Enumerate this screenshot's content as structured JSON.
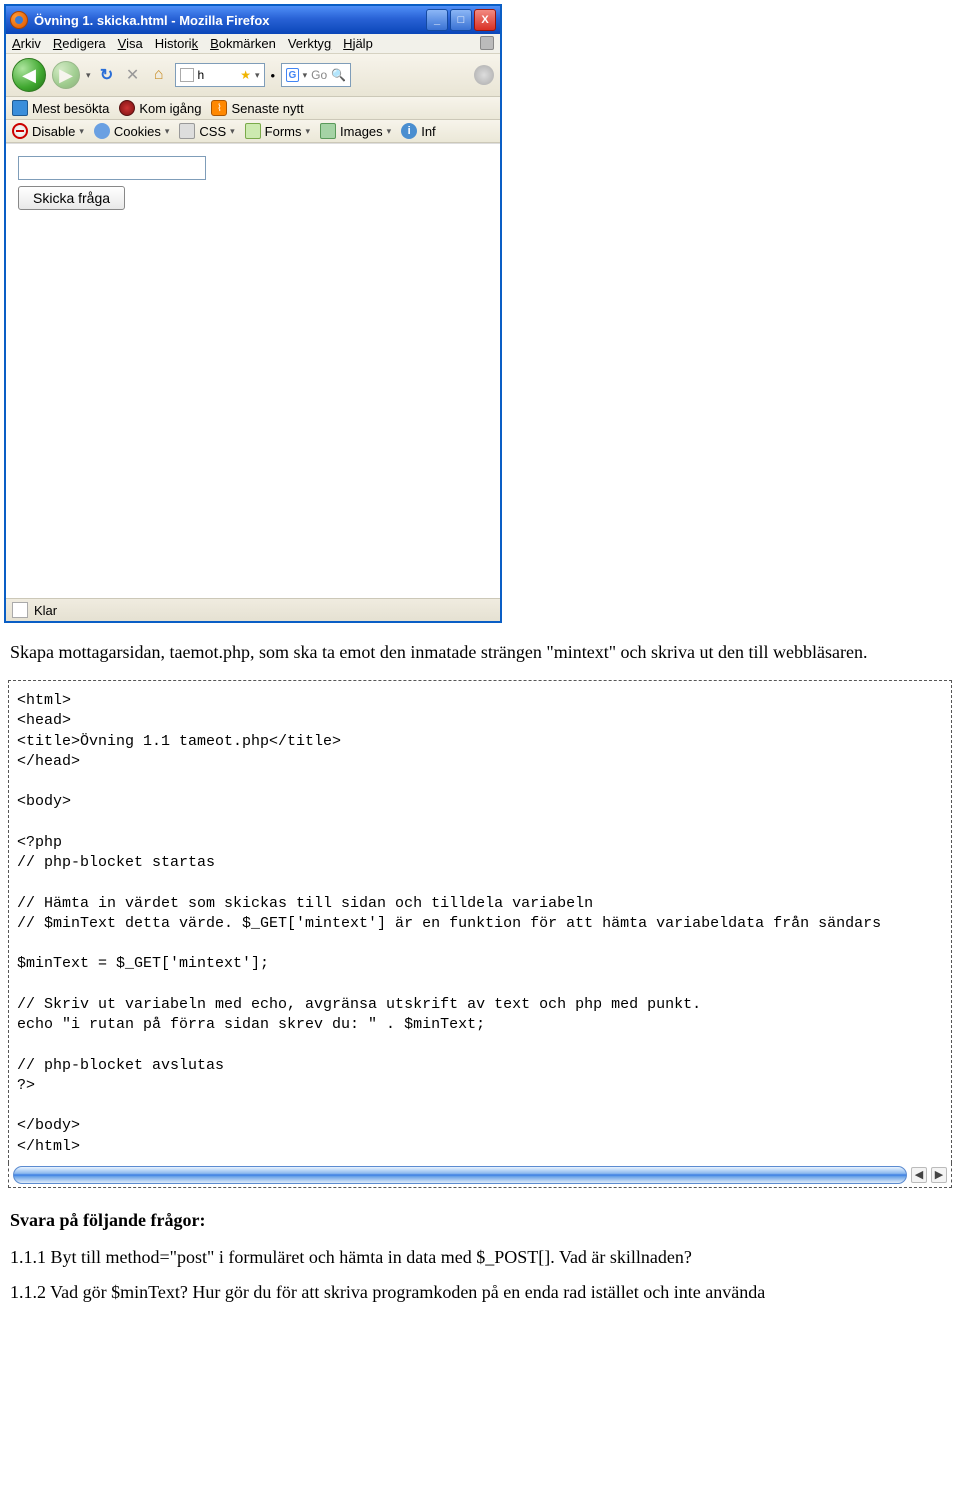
{
  "window": {
    "title": "Övning 1. skicka.html - Mozilla Firefox"
  },
  "menubar": {
    "arkiv": "Arkiv",
    "redigera": "Redigera",
    "visa": "Visa",
    "historik": "Historik",
    "bokmarken": "Bokmärken",
    "verktyg": "Verktyg",
    "hjalp": "Hjälp"
  },
  "url_fragment": "h",
  "search_placeholder": "Go",
  "bookmarks": {
    "most_visited": "Mest besökta",
    "getting_started": "Kom igång",
    "latest_news": "Senaste nytt"
  },
  "devtoolbar": {
    "disable": "Disable",
    "cookies": "Cookies",
    "css": "CSS",
    "forms": "Forms",
    "images": "Images",
    "inf": "Inf"
  },
  "form": {
    "input_value": "",
    "submit_label": "Skicka fråga"
  },
  "status_text": "Klar",
  "intro_paragraph": "Skapa mottagarsidan, taemot.php, som ska ta emot den inmatade strängen \"mintext\" och skriva ut den till webbläsaren.",
  "code": {
    "l1": "<html>",
    "l2": "<head>",
    "l3": "<title>Övning 1.1 tameot.php</title>",
    "l4": "</head>",
    "l5": "<body>",
    "l6": "<?php",
    "l7": "// php-blocket startas",
    "l8": "// Hämta in värdet som skickas till sidan och tilldela variabeln",
    "l9": "// $minText detta värde. $_GET['mintext'] är en funktion för att hämta variabeldata från sändars",
    "l10": "$minText = $_GET['mintext'];",
    "l11": "// Skriv ut variabeln med echo, avgränsa utskrift av text och php med punkt.",
    "l12": "echo \"i rutan på förra sidan skrev du: \" . $minText;",
    "l13": "// php-blocket avslutas",
    "l14": "?>",
    "l15": "</body>",
    "l16": "</html>"
  },
  "questions": {
    "heading": "Svara på följande frågor:",
    "q1": "1.1.1 Byt till method=\"post\" i formuläret och hämta in data med $_POST[]. Vad är skillnaden?",
    "q2": "1.1.2 Vad gör $minText? Hur gör du för att skriva programkoden på en enda rad istället och inte använda"
  }
}
